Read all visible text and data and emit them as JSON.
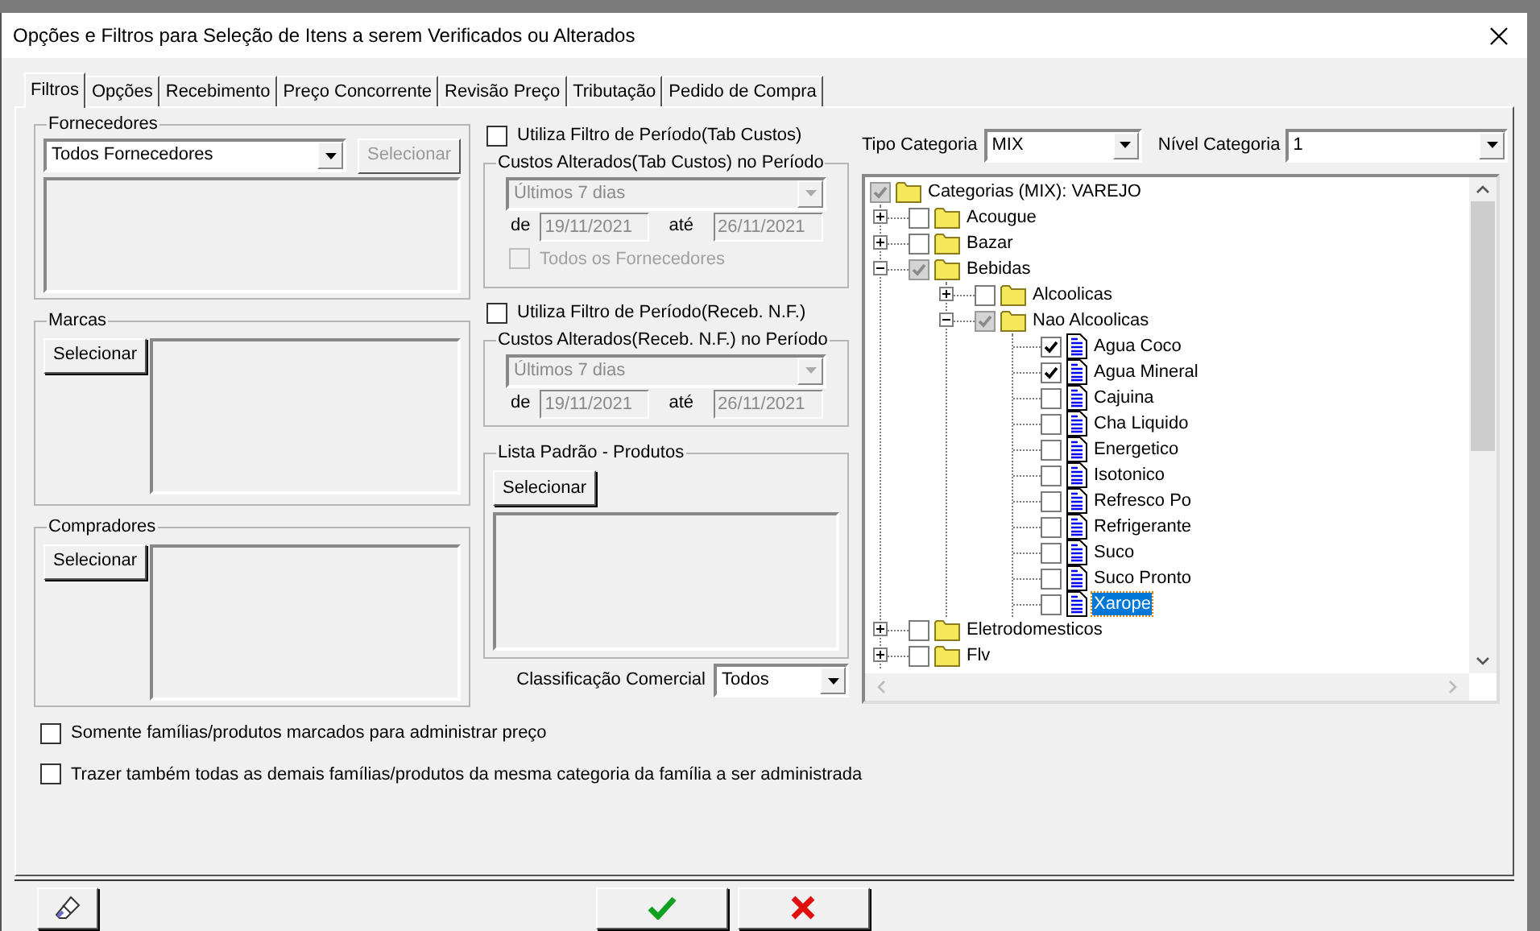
{
  "window": {
    "title": "Opções e Filtros para Seleção de Itens a serem Verificados ou Alterados"
  },
  "tabs": [
    {
      "label": "Filtros",
      "selected": true
    },
    {
      "label": "Opções",
      "selected": false
    },
    {
      "label": "Recebimento",
      "selected": false
    },
    {
      "label": "Preço Concorrente",
      "selected": false
    },
    {
      "label": "Revisão Preço",
      "selected": false
    },
    {
      "label": "Tributação",
      "selected": false
    },
    {
      "label": "Pedido de Compra",
      "selected": false
    }
  ],
  "fornecedores": {
    "title": "Fornecedores",
    "dropdown": {
      "value": "Todos Fornecedores"
    },
    "button": {
      "label": "Selecionar",
      "disabled": true
    }
  },
  "marcas": {
    "title": "Marcas",
    "button": {
      "label": "Selecionar",
      "disabled": false
    }
  },
  "compradores": {
    "title": "Compradores",
    "button": {
      "label": "Selecionar",
      "disabled": false
    }
  },
  "period_filters": [
    {
      "checkbox": {
        "label": "Utiliza Filtro de Período(Tab Custos)",
        "checked": false
      },
      "group_title": "Custos Alterados(Tab Custos) no Período",
      "range": {
        "value": "Últimos 7 dias",
        "disabled": true
      },
      "from_label": "de",
      "from": "19/11/2021",
      "to_label": "até",
      "to": "26/11/2021",
      "all_suppliers": {
        "label": "Todos os Fornecedores",
        "checked": false,
        "disabled": true
      }
    },
    {
      "checkbox": {
        "label": "Utiliza Filtro de Período(Receb. N.F.)",
        "checked": false
      },
      "group_title": "Custos Alterados(Receb. N.F.) no Período",
      "range": {
        "value": "Últimos 7 dias",
        "disabled": true
      },
      "from_label": "de",
      "from": "19/11/2021",
      "to_label": "até",
      "to": "26/11/2021"
    }
  ],
  "lista_padrao": {
    "title": "Lista Padrão -  Produtos",
    "button": {
      "label": "Selecionar",
      "disabled": false
    }
  },
  "classificacao": {
    "label": "Classificação Comercial",
    "value": "Todos"
  },
  "tipo_categoria": {
    "label": "Tipo Categoria",
    "value": "MIX"
  },
  "nivel_categoria": {
    "label": "Nível Categoria",
    "value": "1"
  },
  "tree": {
    "items": [
      {
        "label": "Categorias (MIX): VAREJO",
        "kind": "folder",
        "checked": true,
        "grayed": true,
        "expanded": true,
        "selected": false,
        "children": [
          {
            "label": "Acougue",
            "kind": "folder",
            "checked": false,
            "grayed": false,
            "expanded": false,
            "selected": false
          },
          {
            "label": "Bazar",
            "kind": "folder",
            "checked": false,
            "grayed": false,
            "expanded": false,
            "selected": false
          },
          {
            "label": "Bebidas",
            "kind": "folder",
            "checked": true,
            "grayed": true,
            "expanded": true,
            "selected": false,
            "children": [
              {
                "label": "Alcoolicas",
                "kind": "folder",
                "checked": false,
                "grayed": false,
                "expanded": false,
                "selected": false
              },
              {
                "label": "Nao Alcoolicas",
                "kind": "folder",
                "checked": true,
                "grayed": true,
                "expanded": true,
                "selected": false,
                "children": [
                  {
                    "label": "Agua Coco",
                    "kind": "doc",
                    "checked": true,
                    "grayed": false,
                    "selected": false
                  },
                  {
                    "label": "Agua Mineral",
                    "kind": "doc",
                    "checked": true,
                    "grayed": false,
                    "selected": false
                  },
                  {
                    "label": "Cajuina",
                    "kind": "doc",
                    "checked": false,
                    "grayed": false,
                    "selected": false
                  },
                  {
                    "label": "Cha Liquido",
                    "kind": "doc",
                    "checked": false,
                    "grayed": false,
                    "selected": false
                  },
                  {
                    "label": "Energetico",
                    "kind": "doc",
                    "checked": false,
                    "grayed": false,
                    "selected": false
                  },
                  {
                    "label": "Isotonico",
                    "kind": "doc",
                    "checked": false,
                    "grayed": false,
                    "selected": false
                  },
                  {
                    "label": "Refresco Po",
                    "kind": "doc",
                    "checked": false,
                    "grayed": false,
                    "selected": false
                  },
                  {
                    "label": "Refrigerante",
                    "kind": "doc",
                    "checked": false,
                    "grayed": false,
                    "selected": false
                  },
                  {
                    "label": "Suco",
                    "kind": "doc",
                    "checked": false,
                    "grayed": false,
                    "selected": false
                  },
                  {
                    "label": "Suco Pronto",
                    "kind": "doc",
                    "checked": false,
                    "grayed": false,
                    "selected": false
                  },
                  {
                    "label": "Xarope",
                    "kind": "doc",
                    "checked": false,
                    "grayed": false,
                    "selected": true
                  }
                ]
              }
            ]
          },
          {
            "label": "Eletrodomesticos",
            "kind": "folder",
            "checked": false,
            "grayed": false,
            "expanded": false,
            "selected": false
          },
          {
            "label": "Flv",
            "kind": "folder",
            "checked": false,
            "grayed": false,
            "expanded": false,
            "selected": false
          }
        ]
      }
    ]
  },
  "options": [
    {
      "label": "Somente famílias/produtos marcados para administrar preço",
      "checked": false
    },
    {
      "label": "Trazer também todas as demais famílias/produtos da mesma categoria da família a ser administrada",
      "checked": false
    }
  ]
}
